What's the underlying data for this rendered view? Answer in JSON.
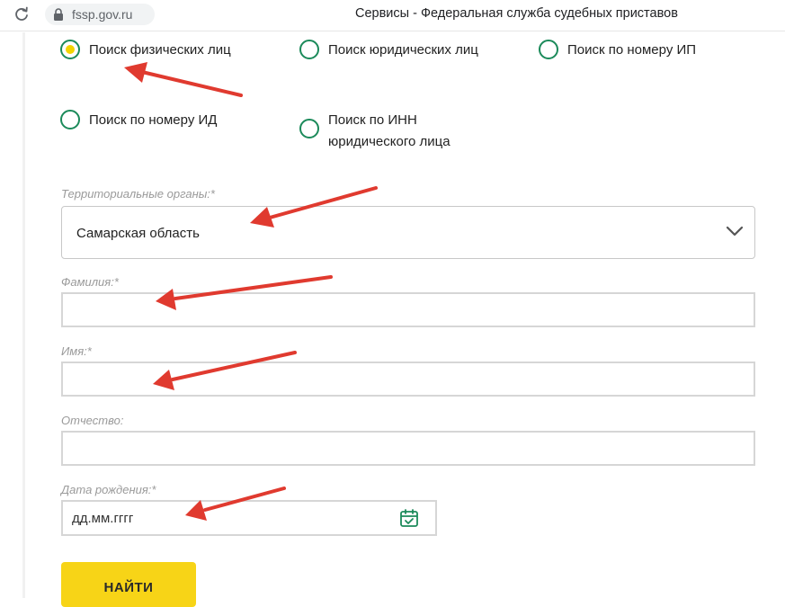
{
  "browser": {
    "url": "fssp.gov.ru",
    "tab_title": "Сервисы - Федеральная служба судебных приставов",
    "reload_icon": "reload-icon",
    "lock_icon": "lock-icon"
  },
  "search_type": {
    "options": [
      {
        "label": "Поиск физических лиц",
        "checked": true
      },
      {
        "label": "Поиск юридических лиц",
        "checked": false
      },
      {
        "label": "Поиск по номеру ИП",
        "checked": false
      },
      {
        "label": "Поиск по номеру ИД",
        "checked": false
      },
      {
        "label": "Поиск по ИНН юридического лица",
        "checked": false
      }
    ]
  },
  "form": {
    "region": {
      "label": "Территориальные органы:*",
      "value": "Самарская область",
      "icon": "chevron-down-icon"
    },
    "last_name": {
      "label": "Фамилия:*",
      "value": ""
    },
    "first_name": {
      "label": "Имя:*",
      "value": ""
    },
    "patronymic": {
      "label": "Отчество:",
      "value": ""
    },
    "birth_date": {
      "label": "Дата рождения:*",
      "placeholder": "дд.мм.гггг",
      "icon": "calendar-icon"
    },
    "submit_label": "НАЙТИ"
  },
  "colors": {
    "radio_border": "#1b8a5a",
    "radio_checked_fill": "#f3d400",
    "button_bg": "#f7d417",
    "annotation_arrow": "#e03a2f",
    "calendar_icon": "#1b8a5a"
  }
}
